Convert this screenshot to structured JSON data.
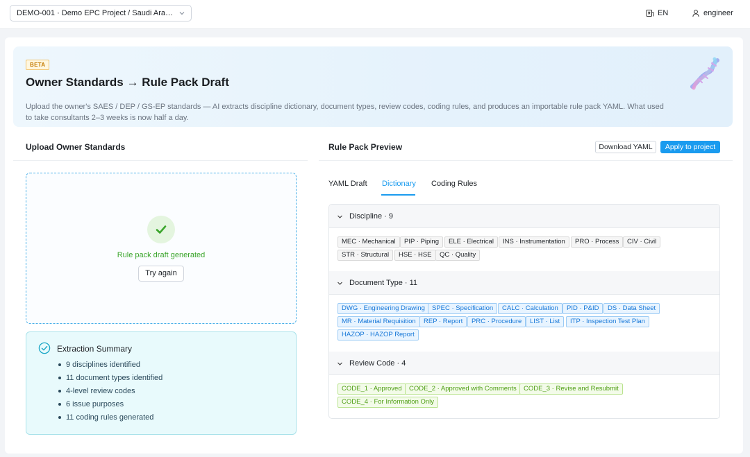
{
  "topbar": {
    "project_select": "DEMO-001 · Demo EPC Project / Saudi Aramco ...",
    "language": "EN",
    "user": "engineer"
  },
  "hero": {
    "badge": "BETA",
    "title": "Owner Standards → Rule Pack Draft",
    "subtitle": "Upload the owner's SAES / DEP / GS-EP standards — AI extracts discipline dictionary, document types, review codes, coding rules, and produces an importable rule pack YAML. What used to take consultants 2–3 weeks is now half a day."
  },
  "upload": {
    "heading": "Upload Owner Standards",
    "status_text": "Rule pack draft generated",
    "try_again": "Try again",
    "summary": {
      "title": "Extraction Summary",
      "items": [
        "9 disciplines identified",
        "11 document types identified",
        "4-level review codes",
        "6 issue purposes",
        "11 coding rules generated"
      ]
    }
  },
  "preview": {
    "heading": "Rule Pack Preview",
    "download_btn": "Download YAML",
    "apply_btn": "Apply to project",
    "tabs": [
      "YAML Draft",
      "Dictionary",
      "Coding Rules"
    ],
    "active_tab": "Dictionary",
    "sections": {
      "discipline": {
        "title": "Discipline · 9",
        "tags": [
          "MEC · Mechanical",
          "PIP · Piping",
          "ELE · Electrical",
          "INS · Instrumentation",
          "PRO · Process",
          "CIV · Civil",
          "STR · Structural",
          "HSE · HSE",
          "QC · Quality"
        ]
      },
      "document_type": {
        "title": "Document Type · 11",
        "tags": [
          "DWG · Engineering Drawing",
          "SPEC · Specification",
          "CALC · Calculation",
          "PID · P&ID",
          "DS · Data Sheet",
          "MR · Material Requisition",
          "REP · Report",
          "PRC · Procedure",
          "LIST · List",
          "ITP · Inspection Test Plan",
          "HAZOP · HAZOP Report"
        ]
      },
      "review_code": {
        "title": "Review Code · 4",
        "tags": [
          "CODE_1 · Approved",
          "CODE_2 · Approved with Comments",
          "CODE_3 · Revise and Resubmit",
          "CODE_4 · For Information Only"
        ]
      }
    }
  },
  "colors": {
    "accent": "#1a9bef",
    "success": "#3aa52b",
    "tag_blue": "#1677d8",
    "tag_green": "#4e9e14"
  },
  "icons": {
    "language": "translate-icon",
    "user": "user-icon",
    "success": "check-icon",
    "summary": "check-circle-icon",
    "expand": "chevron-down-icon"
  }
}
